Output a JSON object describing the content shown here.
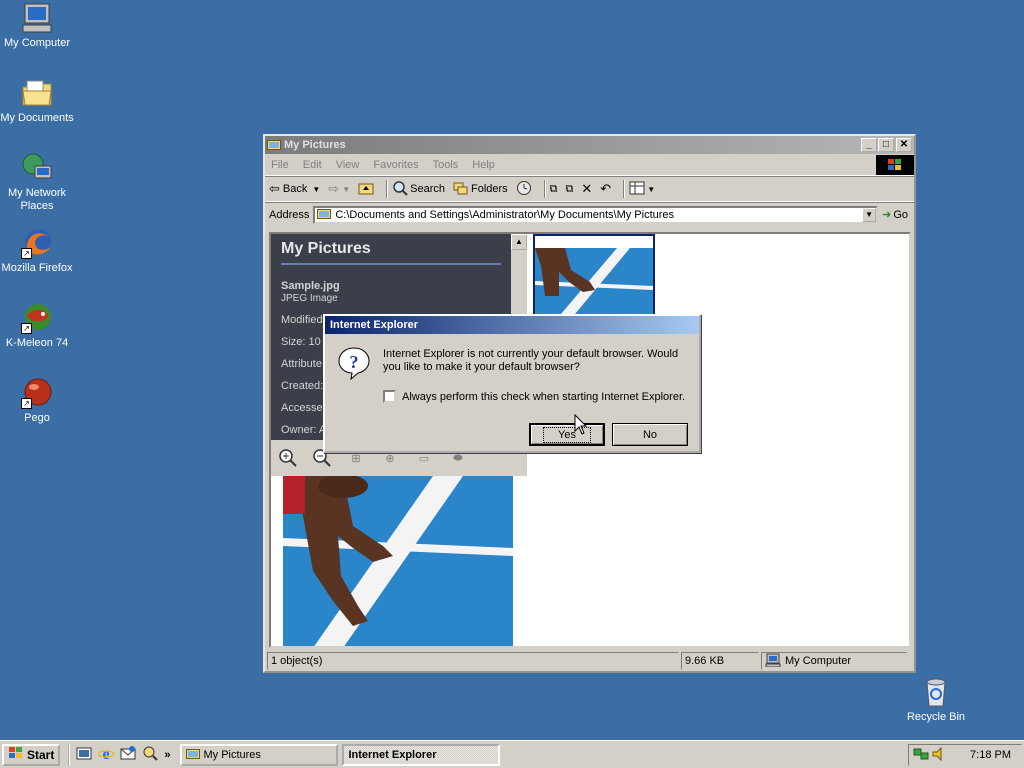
{
  "desktop": {
    "icons": [
      {
        "label": "My Computer",
        "icon": "my-computer-icon"
      },
      {
        "label": "My Documents",
        "icon": "my-documents-icon"
      },
      {
        "label": "My Network Places",
        "icon": "network-places-icon"
      },
      {
        "label": "Mozilla Firefox",
        "icon": "firefox-icon"
      },
      {
        "label": "K-Meleon 74",
        "icon": "k-meleon-icon"
      },
      {
        "label": "Pego",
        "icon": "pego-icon"
      },
      {
        "label": "Recycle Bin",
        "icon": "recycle-bin-icon"
      }
    ]
  },
  "explorer": {
    "title": "My Pictures",
    "menu": [
      "File",
      "Edit",
      "View",
      "Favorites",
      "Tools",
      "Help"
    ],
    "toolbar": {
      "back": "Back",
      "search": "Search",
      "folders": "Folders"
    },
    "address": {
      "label": "Address",
      "value": "C:\\Documents and Settings\\Administrator\\My Documents\\My Pictures",
      "go": "Go"
    },
    "panel": {
      "heading": "My Pictures",
      "file_name": "Sample.jpg",
      "file_type": "JPEG Image",
      "modified": "Modified",
      "size": "Size: 10",
      "attributes": "Attribute",
      "created": "Created:",
      "accessed": "Accessed",
      "owner": "Owner: A"
    },
    "status": {
      "objects": "1 object(s)",
      "size": "9.66 KB",
      "location": "My Computer"
    }
  },
  "dialog": {
    "title": "Internet Explorer",
    "message": "Internet Explorer is not currently your default browser. Would you like to make it your default browser?",
    "checkbox_label": "Always perform this check when starting Internet Explorer.",
    "checkbox_checked": false,
    "yes": "Yes",
    "no": "No"
  },
  "taskbar": {
    "start": "Start",
    "tasks": [
      "My Pictures",
      "Internet Explorer"
    ],
    "clock": "7:18 PM"
  }
}
